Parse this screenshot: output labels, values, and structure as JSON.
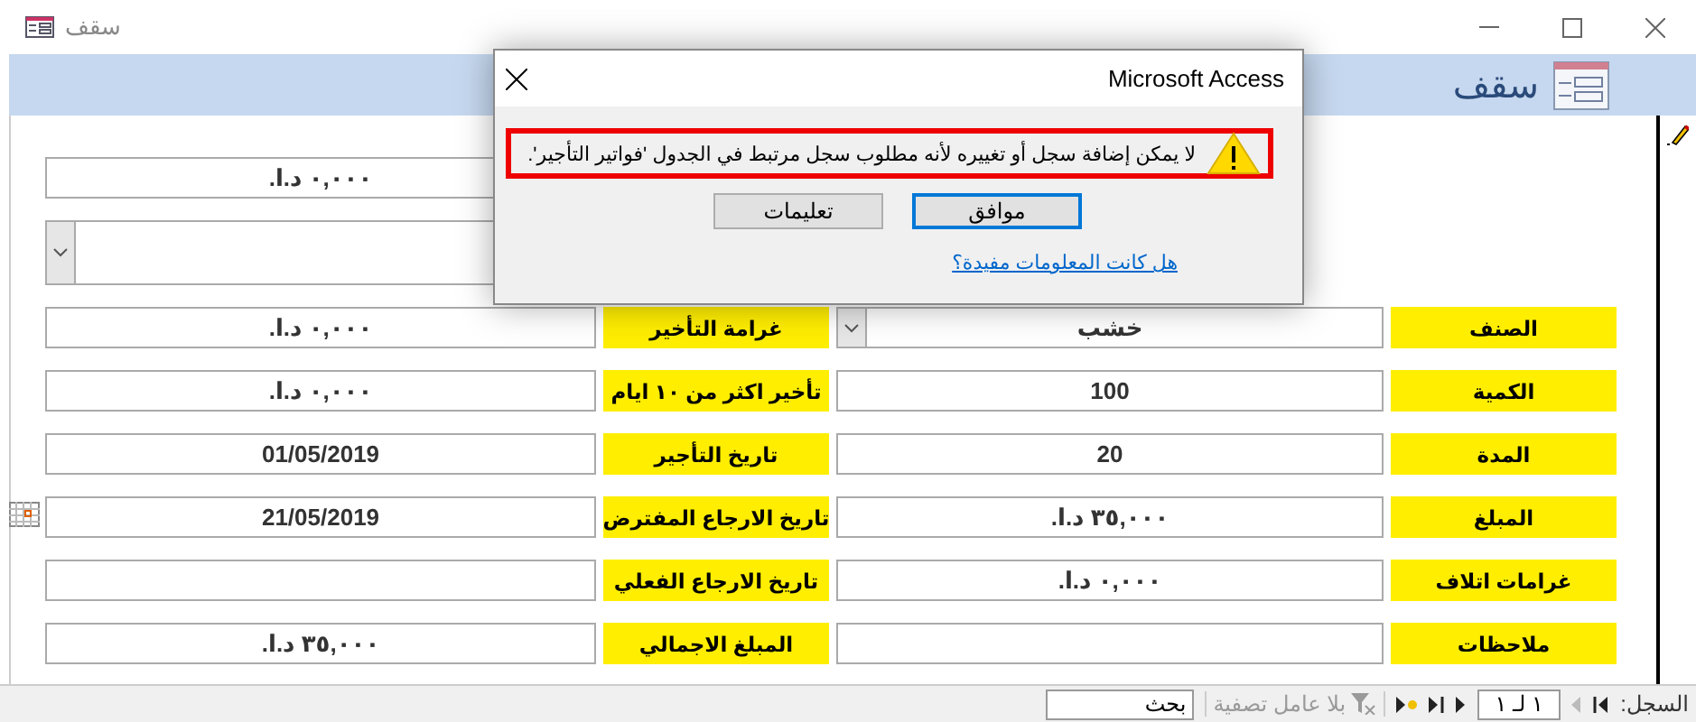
{
  "window": {
    "title": "سقف"
  },
  "form_header": {
    "title": "سقف"
  },
  "top_fields": [
    {
      "kind": "text",
      "value": "٠,٠٠٠ د.ا."
    },
    {
      "kind": "combo"
    }
  ],
  "rows": [
    {
      "right": {
        "label": "الصنف",
        "kind": "combo",
        "value": "خشب"
      },
      "left": {
        "label": "غرامة التأخير",
        "kind": "text",
        "value": "٠,٠٠٠ د.ا."
      }
    },
    {
      "right": {
        "label": "الكمية",
        "kind": "text",
        "value": "100"
      },
      "left": {
        "label": "تأخير اكثر من ١٠ ايام",
        "kind": "text",
        "value": "٠,٠٠٠ د.ا."
      }
    },
    {
      "right": {
        "label": "المدة",
        "kind": "text",
        "value": "20"
      },
      "left": {
        "label": "تاريخ التأجير",
        "kind": "text",
        "value": "01/05/2019"
      }
    },
    {
      "right": {
        "label": "المبلغ",
        "kind": "text",
        "value": "٣٥,٠٠٠ د.ا."
      },
      "left": {
        "label": "تاريخ الارجاع المفترض",
        "kind": "date",
        "value": "21/05/2019"
      }
    },
    {
      "right": {
        "label": "غرامات اتلاف",
        "kind": "text",
        "value": "٠,٠٠٠ د.ا."
      },
      "left": {
        "label": "تاريخ الارجاع الفعلي",
        "kind": "text"
      }
    },
    {
      "right": {
        "label": "ملاحظات",
        "kind": "text"
      },
      "left": {
        "label": "المبلغ الاجمالي",
        "kind": "text",
        "value": "٣٥,٠٠٠ د.ا."
      }
    }
  ],
  "dialog": {
    "title": "Microsoft Access",
    "message": "لا يمكن إضافة سجل أو تغييره لأنه مطلوب سجل مرتبط في الجدول 'فواتير التأجير'.",
    "highlighted": true,
    "buttons": [
      {
        "label": "موافق",
        "selected": true
      },
      {
        "label": "تعليمات",
        "selected": false
      }
    ],
    "link": "هل كانت المعلومات مفيدة؟"
  },
  "status_bar": {
    "label": "السجل:",
    "position": "١ لـ ١",
    "filter": "بلا عامل تصفية",
    "search": {
      "placeholder": "بحث"
    }
  }
}
